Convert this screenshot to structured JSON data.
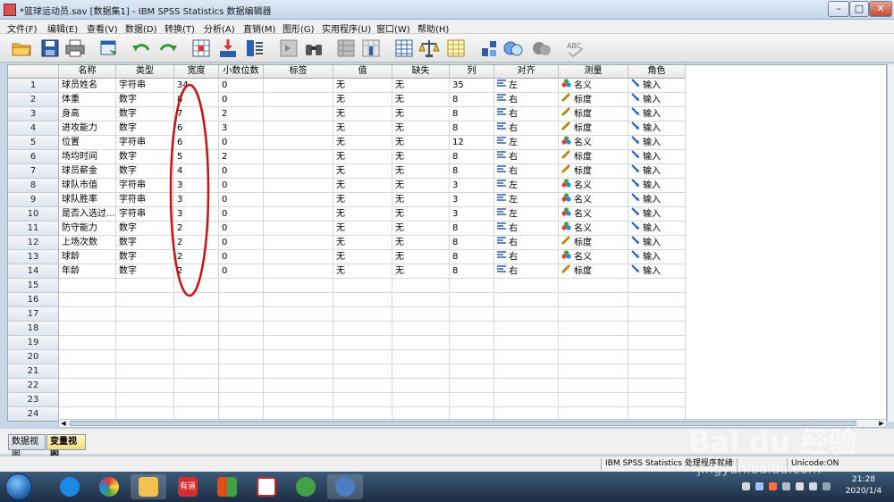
{
  "window": {
    "title": "*篮球运动员.sav [数据集1] - IBM SPSS Statistics 数据编辑器",
    "min_glyph": "–",
    "max_glyph": "□",
    "close_glyph": "✕"
  },
  "menu": [
    "文件(F)",
    "编辑(E)",
    "查看(V)",
    "数据(D)",
    "转换(T)",
    "分析(A)",
    "直销(M)",
    "图形(G)",
    "实用程序(U)",
    "窗口(W)",
    "帮助(H)"
  ],
  "toolbar": {
    "icons": [
      "open-folder-icon",
      "save-icon",
      "print-icon",
      "dialog-recall-icon",
      "undo-icon",
      "redo-icon",
      "goto-case-icon",
      "goto-variable-icon",
      "variables-icon",
      "run-descriptive-icon",
      "find-icon",
      "insert-cases-icon",
      "insert-variable-icon",
      "split-file-icon",
      "weight-cases-icon",
      "select-cases-icon",
      "value-labels-icon",
      "use-variable-sets-icon",
      "show-all-variables-icon",
      "spell-check-icon"
    ]
  },
  "grid": {
    "headers": [
      "名称",
      "类型",
      "宽度",
      "小数位数",
      "标签",
      "值",
      "缺失",
      "列",
      "对齐",
      "测量",
      "角色"
    ],
    "rows": [
      {
        "n": "1",
        "name": "球员姓名",
        "type": "字符串",
        "width": "34",
        "dec": "0",
        "label": "",
        "values": "无",
        "missing": "无",
        "columns": "35",
        "align": "左",
        "measure": "名义",
        "role": "输入"
      },
      {
        "n": "2",
        "name": "体重",
        "type": "数字",
        "width": "8",
        "dec": "0",
        "label": "",
        "values": "无",
        "missing": "无",
        "columns": "8",
        "align": "右",
        "measure": "标度",
        "role": "输入"
      },
      {
        "n": "3",
        "name": "身高",
        "type": "数字",
        "width": "7",
        "dec": "2",
        "label": "",
        "values": "无",
        "missing": "无",
        "columns": "8",
        "align": "右",
        "measure": "标度",
        "role": "输入"
      },
      {
        "n": "4",
        "name": "进攻能力",
        "type": "数字",
        "width": "6",
        "dec": "3",
        "label": "",
        "values": "无",
        "missing": "无",
        "columns": "8",
        "align": "右",
        "measure": "标度",
        "role": "输入"
      },
      {
        "n": "5",
        "name": "位置",
        "type": "字符串",
        "width": "6",
        "dec": "0",
        "label": "",
        "values": "无",
        "missing": "无",
        "columns": "12",
        "align": "左",
        "measure": "名义",
        "role": "输入"
      },
      {
        "n": "6",
        "name": "场均时间",
        "type": "数字",
        "width": "5",
        "dec": "2",
        "label": "",
        "values": "无",
        "missing": "无",
        "columns": "8",
        "align": "右",
        "measure": "标度",
        "role": "输入"
      },
      {
        "n": "7",
        "name": "球员薪金",
        "type": "数字",
        "width": "4",
        "dec": "0",
        "label": "",
        "values": "无",
        "missing": "无",
        "columns": "8",
        "align": "右",
        "measure": "标度",
        "role": "输入"
      },
      {
        "n": "8",
        "name": "球队市值",
        "type": "字符串",
        "width": "3",
        "dec": "0",
        "label": "",
        "values": "无",
        "missing": "无",
        "columns": "3",
        "align": "左",
        "measure": "名义",
        "role": "输入"
      },
      {
        "n": "9",
        "name": "球队胜率",
        "type": "字符串",
        "width": "3",
        "dec": "0",
        "label": "",
        "values": "无",
        "missing": "无",
        "columns": "3",
        "align": "左",
        "measure": "名义",
        "role": "输入"
      },
      {
        "n": "10",
        "name": "是否入选过...",
        "type": "字符串",
        "width": "3",
        "dec": "0",
        "label": "",
        "values": "无",
        "missing": "无",
        "columns": "3",
        "align": "左",
        "measure": "名义",
        "role": "输入"
      },
      {
        "n": "11",
        "name": "防守能力",
        "type": "数字",
        "width": "2",
        "dec": "0",
        "label": "",
        "values": "无",
        "missing": "无",
        "columns": "8",
        "align": "右",
        "measure": "名义",
        "role": "输入"
      },
      {
        "n": "12",
        "name": "上场次数",
        "type": "数字",
        "width": "2",
        "dec": "0",
        "label": "",
        "values": "无",
        "missing": "无",
        "columns": "8",
        "align": "右",
        "measure": "标度",
        "role": "输入"
      },
      {
        "n": "13",
        "name": "球龄",
        "type": "数字",
        "width": "2",
        "dec": "0",
        "label": "",
        "values": "无",
        "missing": "无",
        "columns": "8",
        "align": "右",
        "measure": "名义",
        "role": "输入"
      },
      {
        "n": "14",
        "name": "年龄",
        "type": "数字",
        "width": "2",
        "dec": "0",
        "label": "",
        "values": "无",
        "missing": "无",
        "columns": "8",
        "align": "右",
        "measure": "标度",
        "role": "输入"
      }
    ],
    "empty_rows": [
      "15",
      "16",
      "17",
      "18",
      "19",
      "20",
      "21",
      "22",
      "23",
      "24"
    ],
    "annotation_color": "#cc1111"
  },
  "tabs": {
    "data_view": "数据视图",
    "variable_view": "变量视图"
  },
  "status": {
    "processor": "IBM SPSS Statistics 处理程序就绪",
    "unicode": "Unicode:ON"
  },
  "taskbar": {
    "apps": [
      "sogou-icon",
      "browser-icon",
      "explorer-icon",
      "youdao-icon",
      "office-icon",
      "wps-icon",
      "wechat-icon",
      "spss-icon"
    ],
    "youdao_label": "有道",
    "time": "21:28",
    "date": "2020/1/4"
  },
  "watermark": {
    "text": "Bai du 经验",
    "sub": "jingyan.baidu.com"
  }
}
